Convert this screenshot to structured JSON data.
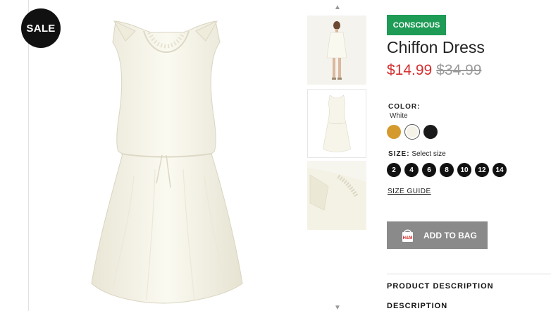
{
  "badge": {
    "label": "SALE"
  },
  "thumbnails": {
    "count": 3,
    "selected_index": 1
  },
  "product": {
    "tag": "CONSCIOUS",
    "name": "Chiffon Dress",
    "price_sale": "$14.99",
    "price_original": "$34.99",
    "color": {
      "label": "COLOR:",
      "value": "White",
      "swatches": [
        {
          "name": "mustard",
          "hex": "#d49a2c"
        },
        {
          "name": "white",
          "hex": "#f5f3e8",
          "selected": true
        },
        {
          "name": "black",
          "hex": "#1a1a1a"
        }
      ]
    },
    "size": {
      "label": "SIZE:",
      "hint": "Select size",
      "options": [
        "2",
        "4",
        "6",
        "8",
        "10",
        "12",
        "14"
      ]
    },
    "size_guide": "SIZE GUIDE",
    "add_to_bag": "ADD TO BAG",
    "brand_mark": "H&M"
  },
  "sections": {
    "product_description": "PRODUCT DESCRIPTION",
    "description": "DESCRIPTION"
  },
  "colors": {
    "conscious_green": "#1e9b55",
    "sale_red": "#d62e2e",
    "button_grey": "#8a8a8a"
  }
}
